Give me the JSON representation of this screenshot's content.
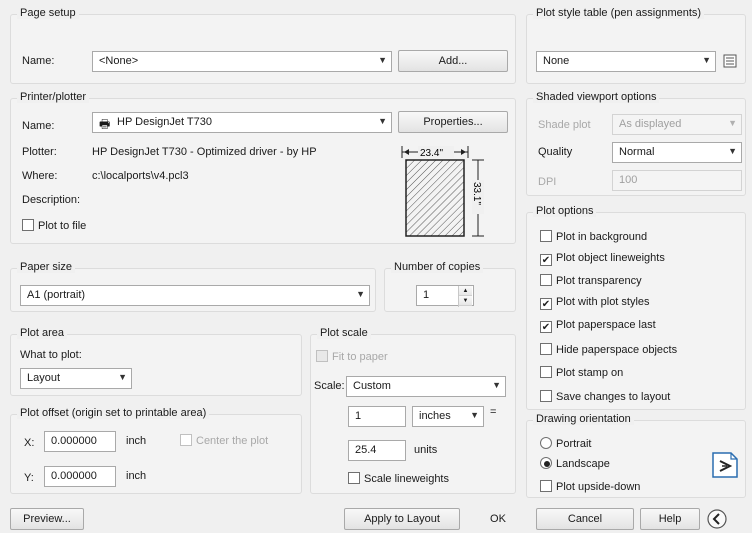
{
  "page_setup": {
    "title": "Page setup",
    "name_label": "Name:",
    "name_value": "<None>",
    "add_button": "Add..."
  },
  "printer": {
    "title": "Printer/plotter",
    "name_label": "Name:",
    "name_value": "HP DesignJet T730",
    "properties_button": "Properties...",
    "plotter_label": "Plotter:",
    "plotter_value": "HP DesignJet T730 - Optimized driver - by HP",
    "where_label": "Where:",
    "where_value": "c:\\localports\\v4.pcl3",
    "description_label": "Description:",
    "plot_to_file_label": "Plot to file",
    "preview_width": "23.4\"",
    "preview_height": "33.1\""
  },
  "paper_size": {
    "title": "Paper size",
    "value": "A1 (portrait)"
  },
  "copies": {
    "title": "Number of copies",
    "value": "1"
  },
  "plot_area": {
    "title": "Plot area",
    "what_label": "What to plot:",
    "what_value": "Layout"
  },
  "plot_offset": {
    "title": "Plot offset (origin set to printable area)",
    "x_label": "X:",
    "x_value": "0.000000",
    "x_unit": "inch",
    "y_label": "Y:",
    "y_value": "0.000000",
    "y_unit": "inch",
    "center_label": "Center the plot"
  },
  "plot_scale": {
    "title": "Plot scale",
    "fit_label": "Fit to paper",
    "scale_label": "Scale:",
    "scale_value": "Custom",
    "value1": "1",
    "unit1": "inches",
    "equals": "=",
    "value2": "25.4",
    "unit2": "units",
    "scale_lineweights_label": "Scale lineweights"
  },
  "plot_style_table": {
    "title": "Plot style table (pen assignments)",
    "value": "None"
  },
  "shaded": {
    "title": "Shaded viewport options",
    "shade_label": "Shade plot",
    "shade_value": "As displayed",
    "quality_label": "Quality",
    "quality_value": "Normal",
    "dpi_label": "DPI",
    "dpi_value": "100"
  },
  "plot_options": {
    "title": "Plot options",
    "items": [
      {
        "label": "Plot in background",
        "checked": false
      },
      {
        "label": "Plot object lineweights",
        "checked": true
      },
      {
        "label": "Plot transparency",
        "checked": false
      },
      {
        "label": "Plot with plot styles",
        "checked": true
      },
      {
        "label": "Plot paperspace last",
        "checked": true
      },
      {
        "label": "Hide paperspace objects",
        "checked": false
      },
      {
        "label": "Plot stamp on",
        "checked": false
      },
      {
        "label": "Save changes to layout",
        "checked": false
      }
    ]
  },
  "orientation": {
    "title": "Drawing orientation",
    "portrait": "Portrait",
    "landscape": "Landscape",
    "upside_down": "Plot upside-down",
    "selected": "landscape"
  },
  "footer": {
    "preview": "Preview...",
    "apply": "Apply to Layout",
    "ok": "OK",
    "cancel": "Cancel",
    "help": "Help"
  }
}
